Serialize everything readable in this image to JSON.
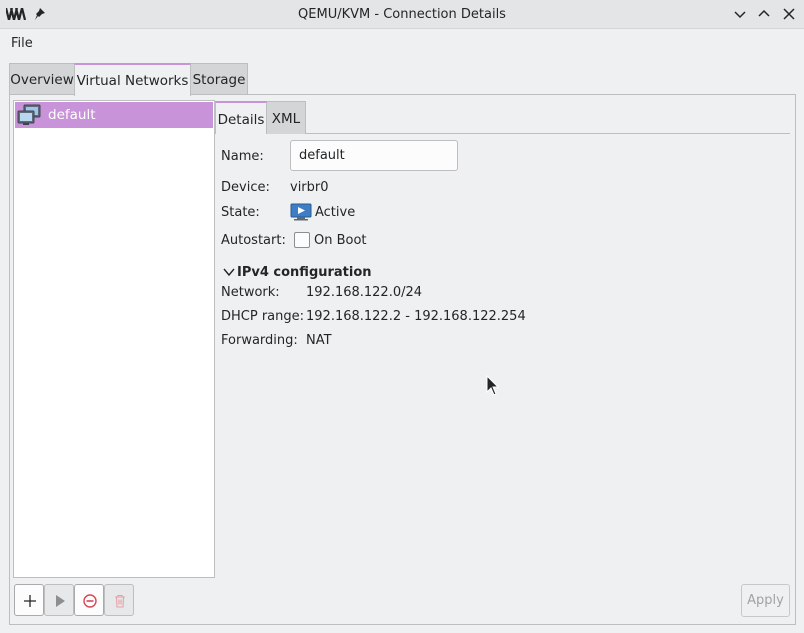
{
  "window": {
    "title": "QEMU/KVM - Connection Details",
    "icons": {
      "app": "virt-manager-logo-icon",
      "pin": "pin-icon",
      "minimize": "chevron-down-icon",
      "maximize": "chevron-up-icon",
      "close": "close-icon"
    }
  },
  "menubar": {
    "items": [
      "File"
    ]
  },
  "tabs": [
    {
      "label": "Overview",
      "active": false
    },
    {
      "label": "Virtual Networks",
      "active": true
    },
    {
      "label": "Storage",
      "active": false
    }
  ],
  "network_list": {
    "items": [
      {
        "label": "default",
        "selected": true,
        "icon": "network-icon"
      }
    ]
  },
  "subtabs": [
    {
      "label": "Details",
      "active": true
    },
    {
      "label": "XML",
      "active": false
    }
  ],
  "details": {
    "name_label": "Name:",
    "name_value": "default",
    "device_label": "Device:",
    "device_value": "virbr0",
    "state_label": "State:",
    "state_value": "Active",
    "state_icon": "monitor-play-icon",
    "autostart_label": "Autostart:",
    "autostart_option": "On Boot",
    "autostart_checked": false
  },
  "ipv4": {
    "title": "IPv4 configuration",
    "expanded": true,
    "network_label": "Network:",
    "network_value": "192.168.122.0/24",
    "dhcp_label": "DHCP range:",
    "dhcp_value": "192.168.122.2 - 192.168.122.254",
    "forwarding_label": "Forwarding:",
    "forwarding_value": "NAT"
  },
  "toolbar": {
    "buttons": [
      {
        "icon": "add-icon",
        "enabled": true
      },
      {
        "icon": "play-icon",
        "enabled": false
      },
      {
        "icon": "stop-icon",
        "enabled": true
      },
      {
        "icon": "delete-icon",
        "enabled": false
      }
    ],
    "apply_label": "Apply",
    "apply_enabled": false
  },
  "colors": {
    "accent": "#c993d9",
    "window_bg": "#eff0f1",
    "text": "#232627",
    "stop_red": "#da4453"
  }
}
